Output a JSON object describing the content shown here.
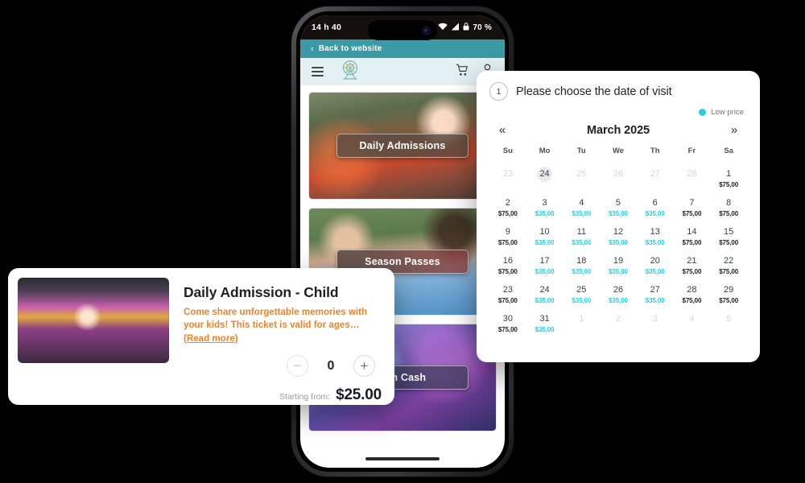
{
  "phone": {
    "status_bar": {
      "time": "14 h 40",
      "battery_text": "70 %",
      "icons": [
        "mute-icon",
        "wifi-icon",
        "signal-icon",
        "battery-lock-icon"
      ]
    },
    "back_bar": {
      "chevron": "‹",
      "label": "Back to website"
    },
    "app_bar": {
      "menu_icon": "hamburger-menu-icon",
      "logo": "ferris-wheel-logo",
      "cart_icon": "shopping-cart-icon",
      "account_icon": "user-account-icon"
    },
    "feed": [
      {
        "banner": "Daily Admissions",
        "image": "swing-ride-riders-photo"
      },
      {
        "banner": "Season Passes",
        "image": "water-park-float-photo"
      },
      {
        "banner": "Fun Cash",
        "image": "neon-arcade-photo"
      }
    ]
  },
  "product_card": {
    "image": "family-at-fairground-photo",
    "title": "Daily Admission - Child",
    "description": "Come share unforgettable memories with your kids! This ticket is valid for ages…",
    "read_more": "(Read more)",
    "quantity": {
      "minus_label": "−",
      "value": "0",
      "plus_label": "+"
    },
    "price_label": "Starting from:",
    "price_value": "$25.00",
    "accent_color": "#f0822a"
  },
  "calendar": {
    "step_number": "1",
    "title": "Please choose the date of visit",
    "legend": {
      "label": "Low price",
      "color": "#29cfdc"
    },
    "prev_arrow": "«",
    "next_arrow": "»",
    "month": "March 2025",
    "weekdays": [
      "Su",
      "Mo",
      "Tu",
      "We",
      "Th",
      "Fr",
      "Sa"
    ],
    "days": [
      {
        "num": "23",
        "amount": "",
        "state": "muted"
      },
      {
        "num": "24",
        "amount": "",
        "state": "today"
      },
      {
        "num": "25",
        "amount": "",
        "state": "muted"
      },
      {
        "num": "26",
        "amount": "",
        "state": "muted"
      },
      {
        "num": "27",
        "amount": "",
        "state": "muted"
      },
      {
        "num": "28",
        "amount": "",
        "state": "muted"
      },
      {
        "num": "1",
        "amount": "$75,00",
        "state": "normal"
      },
      {
        "num": "2",
        "amount": "$75,00",
        "state": "normal"
      },
      {
        "num": "3",
        "amount": "$35,00",
        "state": "low"
      },
      {
        "num": "4",
        "amount": "$35,00",
        "state": "low"
      },
      {
        "num": "5",
        "amount": "$35,00",
        "state": "low"
      },
      {
        "num": "6",
        "amount": "$35,00",
        "state": "low"
      },
      {
        "num": "7",
        "amount": "$75,00",
        "state": "normal"
      },
      {
        "num": "8",
        "amount": "$75,00",
        "state": "normal"
      },
      {
        "num": "9",
        "amount": "$75,00",
        "state": "normal"
      },
      {
        "num": "10",
        "amount": "$35,00",
        "state": "low"
      },
      {
        "num": "11",
        "amount": "$35,00",
        "state": "low"
      },
      {
        "num": "12",
        "amount": "$35,00",
        "state": "low"
      },
      {
        "num": "13",
        "amount": "$35,00",
        "state": "low"
      },
      {
        "num": "14",
        "amount": "$75,00",
        "state": "normal"
      },
      {
        "num": "15",
        "amount": "$75,00",
        "state": "normal"
      },
      {
        "num": "16",
        "amount": "$75,00",
        "state": "normal"
      },
      {
        "num": "17",
        "amount": "$35,00",
        "state": "low"
      },
      {
        "num": "18",
        "amount": "$35,00",
        "state": "low"
      },
      {
        "num": "19",
        "amount": "$35,00",
        "state": "low"
      },
      {
        "num": "20",
        "amount": "$35,00",
        "state": "low"
      },
      {
        "num": "21",
        "amount": "$75,00",
        "state": "normal"
      },
      {
        "num": "22",
        "amount": "$75,00",
        "state": "normal"
      },
      {
        "num": "23",
        "amount": "$75,00",
        "state": "normal"
      },
      {
        "num": "24",
        "amount": "$35,00",
        "state": "low"
      },
      {
        "num": "25",
        "amount": "$35,00",
        "state": "low"
      },
      {
        "num": "26",
        "amount": "$35,00",
        "state": "low"
      },
      {
        "num": "27",
        "amount": "$35,00",
        "state": "low"
      },
      {
        "num": "28",
        "amount": "$75,00",
        "state": "normal"
      },
      {
        "num": "29",
        "amount": "$75,00",
        "state": "normal"
      },
      {
        "num": "30",
        "amount": "$75,00",
        "state": "normal"
      },
      {
        "num": "31",
        "amount": "$35,00",
        "state": "low"
      },
      {
        "num": "1",
        "amount": "",
        "state": "muted"
      },
      {
        "num": "2",
        "amount": "",
        "state": "muted"
      },
      {
        "num": "3",
        "amount": "",
        "state": "muted"
      },
      {
        "num": "4",
        "amount": "",
        "state": "muted"
      },
      {
        "num": "5",
        "amount": "",
        "state": "muted"
      }
    ]
  }
}
